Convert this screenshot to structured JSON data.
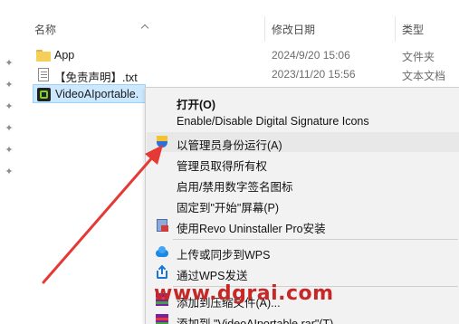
{
  "explorer": {
    "columns": {
      "name": "名称",
      "date": "修改日期",
      "type": "类型"
    },
    "files": [
      {
        "icon": "folder-icon",
        "name": "App",
        "date": "2024/9/20 15:06",
        "type": "文件夹"
      },
      {
        "icon": "text-file-icon",
        "name": "【免责声明】.txt",
        "date": "2023/11/20 15:56",
        "type": "文本文档"
      },
      {
        "icon": "app-icon",
        "name": "VideoAIportable.",
        "date": "",
        "type": ""
      }
    ]
  },
  "context_menu": {
    "items": [
      {
        "label": "打开(O)",
        "bold": true
      },
      {
        "label": "Enable/Disable Digital Signature Icons"
      },
      {
        "label": "以管理员身份运行(A)",
        "icon": "shield-icon"
      },
      {
        "label": "管理员取得所有权"
      },
      {
        "label": "启用/禁用数字签名图标"
      },
      {
        "label": "固定到\"开始\"屏幕(P)"
      },
      {
        "label": "使用Revo Uninstaller Pro安装",
        "icon": "revo-uninstaller-icon"
      },
      {
        "label": "上传或同步到WPS",
        "icon": "cloud-icon"
      },
      {
        "label": "通过WPS发送",
        "icon": "share-icon"
      },
      {
        "label": "添加到压缩文件(A)...",
        "icon": "winrar-icon"
      },
      {
        "label": "添加到 \"VideoAIportable.rar\"(T)",
        "icon": "winrar-icon"
      }
    ]
  },
  "watermark": "www.dgrai.com",
  "colors": {
    "selection": "#cce8ff",
    "menu_bg": "#f2f2f2",
    "arrow": "#e53935",
    "watermark": "#c62828"
  }
}
